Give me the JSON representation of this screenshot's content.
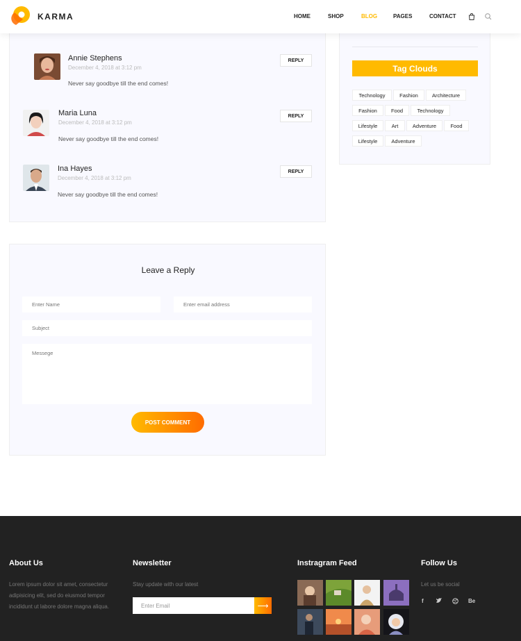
{
  "header": {
    "brand": "KARMA",
    "nav": [
      {
        "label": "HOME",
        "active": false
      },
      {
        "label": "SHOP",
        "active": false
      },
      {
        "label": "BLOG",
        "active": true
      },
      {
        "label": "PAGES",
        "active": false
      },
      {
        "label": "CONTACT",
        "active": false
      }
    ],
    "icons": [
      "cart-icon",
      "search-icon"
    ],
    "accent_color": "#ffba00"
  },
  "comments": [
    {
      "name": "Annie Stephens",
      "date": "December 4, 2018 at 3:12 pm",
      "text": "Never say goodbye till the end comes!",
      "reply_label": "REPLY"
    },
    {
      "name": "Maria Luna",
      "date": "December 4, 2018 at 3:12 pm",
      "text": "Never say goodbye till the end comes!",
      "reply_label": "REPLY"
    },
    {
      "name": "Ina Hayes",
      "date": "December 4, 2018 at 3:12 pm",
      "text": "Never say goodbye till the end comes!",
      "reply_label": "REPLY"
    }
  ],
  "sidebar": {
    "tag_title": "Tag Clouds",
    "tags": [
      "Technology",
      "Fashion",
      "Architecture",
      "Fashion",
      "Food",
      "Technology",
      "Lifestyle",
      "Art",
      "Adventure",
      "Food",
      "Lifestyle",
      "Adventure"
    ]
  },
  "reply_form": {
    "title": "Leave a Reply",
    "name_placeholder": "Enter Name",
    "email_placeholder": "Enter email address",
    "subject_placeholder": "Subject",
    "message_placeholder": "Messege",
    "submit_label": "POST COMMENT"
  },
  "footer": {
    "about": {
      "title": "About Us",
      "text": "Lorem ipsum dolor sit amet, consectetur adipisicing elit, sed do eiusmod tempor incididunt ut labore dolore magna aliqua."
    },
    "newsletter": {
      "title": "Newsletter",
      "text": "Stay update with our latest",
      "placeholder": "Enter Email",
      "button_icon": "arrow-right-icon"
    },
    "instagram": {
      "title": "Instragram Feed"
    },
    "follow": {
      "title": "Follow Us",
      "text": "Let us be social",
      "socials": [
        {
          "label": "f",
          "icon": "facebook-icon"
        },
        {
          "label": "t",
          "icon": "twitter-icon"
        },
        {
          "label": "d",
          "icon": "dribbble-icon"
        },
        {
          "label": "Be",
          "icon": "behance-icon"
        }
      ]
    }
  }
}
